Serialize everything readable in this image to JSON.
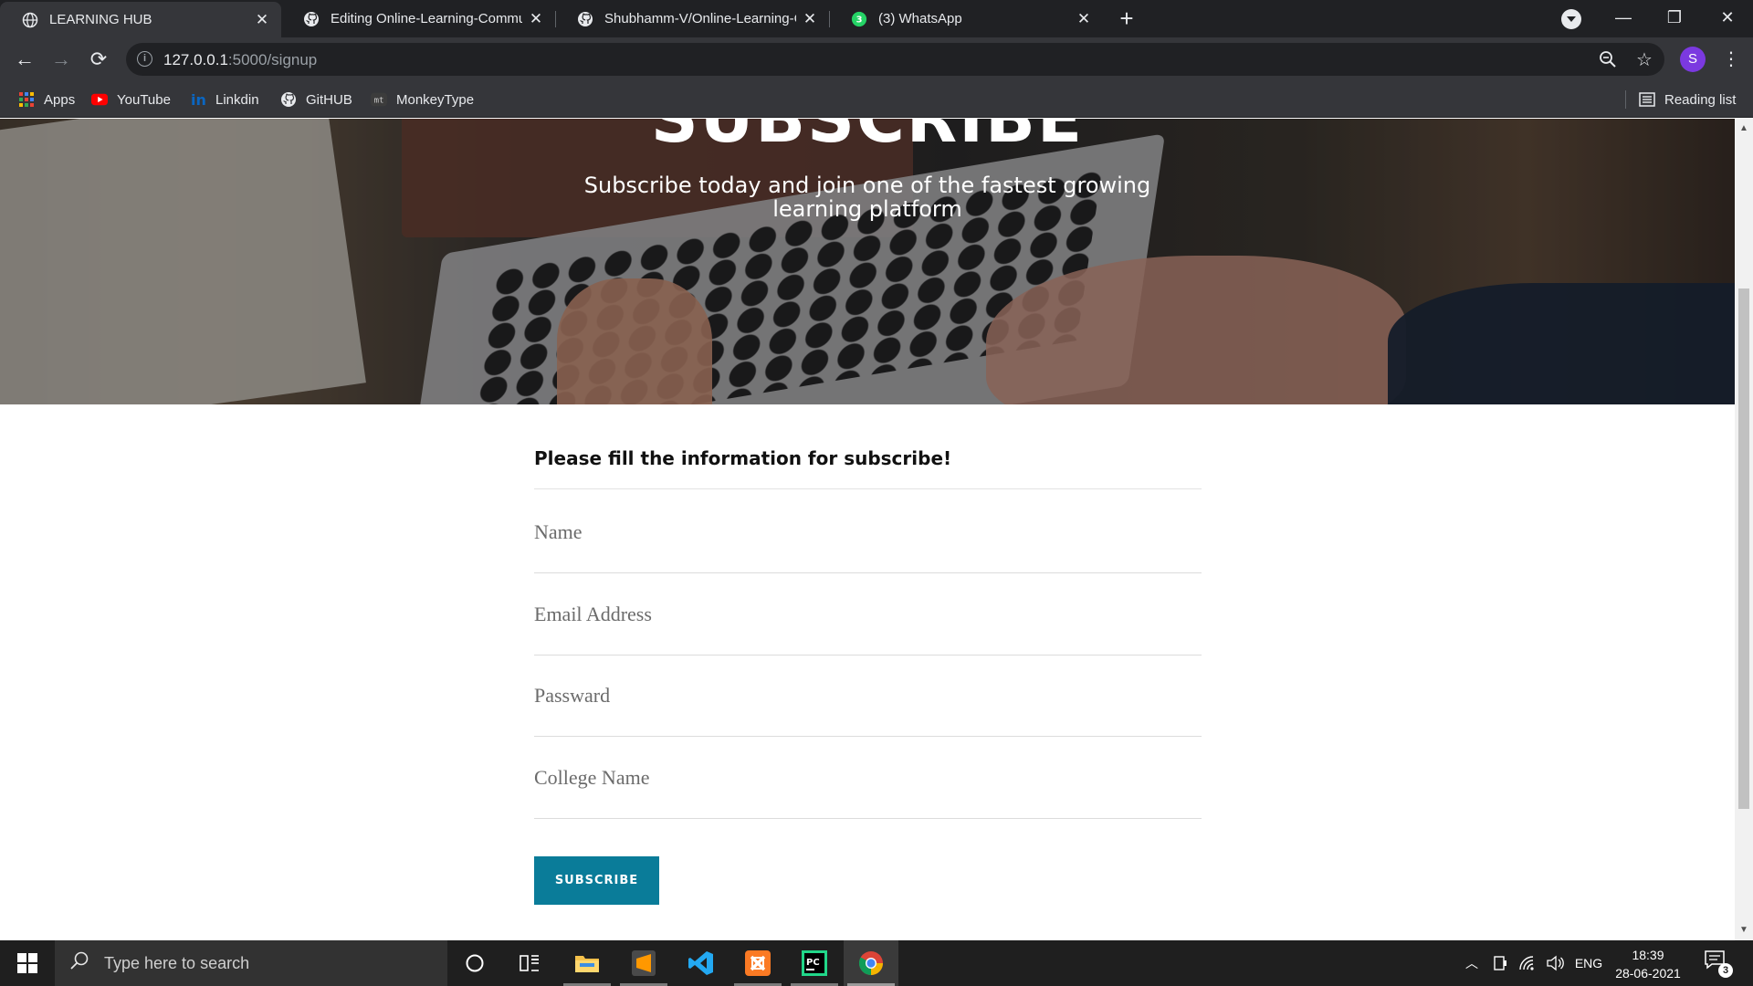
{
  "browser": {
    "tabs": [
      {
        "title": "LEARNING HUB",
        "icon": "globe-icon",
        "active": true
      },
      {
        "title": "Editing Online-Learning-Commun",
        "icon": "github-icon",
        "active": false
      },
      {
        "title": "Shubhamm-V/Online-Learning-C",
        "icon": "github-icon",
        "active": false
      },
      {
        "title": "(3) WhatsApp",
        "icon": "whatsapp-icon",
        "active": false,
        "badge": "3"
      }
    ],
    "url_host": "127.0.0.1",
    "url_path": ":5000/signup",
    "profile_initial": "S",
    "bookmarks": [
      {
        "label": "Apps",
        "icon": "apps-grid-icon"
      },
      {
        "label": "YouTube",
        "icon": "youtube-icon"
      },
      {
        "label": "Linkdin",
        "icon": "linkedin-icon"
      },
      {
        "label": "GitHUB",
        "icon": "github-icon"
      },
      {
        "label": "MonkeyType",
        "icon": "monkeytype-icon",
        "icon_text": "mt"
      }
    ],
    "reading_list": "Reading list"
  },
  "hero": {
    "title": "SUBSCRIBE",
    "subtitle": "Subscribe today and join one of the fastest growing learning platform"
  },
  "form": {
    "heading": "Please fill the information for subscribe!",
    "fields": [
      {
        "placeholder": "Name"
      },
      {
        "placeholder": "Email Address"
      },
      {
        "placeholder": "Passward"
      },
      {
        "placeholder": "College Name"
      }
    ],
    "submit_label": "SUBSCRIBE"
  },
  "taskbar": {
    "search_placeholder": "Type here to search",
    "language": "ENG",
    "time": "18:39",
    "date": "28-06-2021",
    "notification_count": "3",
    "pinned": [
      "task-view-icon",
      "file-explorer-icon",
      "sublime-text-icon",
      "vscode-icon",
      "xampp-icon",
      "pycharm-icon",
      "chrome-icon"
    ]
  },
  "colors": {
    "accent": "#0a7c99",
    "tab_bg": "#202124",
    "toolbar_bg": "#35363a",
    "taskbar_bg": "#1f1f1f"
  }
}
